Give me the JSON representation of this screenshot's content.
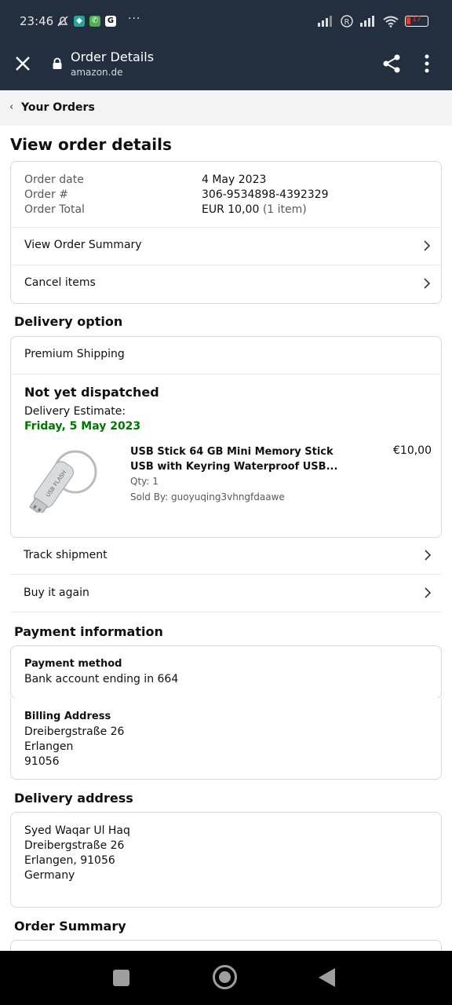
{
  "status_bar": {
    "time": "23:46",
    "battery": "17",
    "more": "···"
  },
  "browser": {
    "title": "Order Details",
    "domain": "amazon.de"
  },
  "breadcrumb": {
    "label": "Your Orders"
  },
  "page_title": "View order details",
  "order": {
    "date_label": "Order date",
    "date": "4 May 2023",
    "number_label": "Order #",
    "number": "306-9534898-4392329",
    "total_label": "Order Total",
    "total": "EUR 10,00",
    "items": "(1 item)",
    "view_summary": "View Order Summary",
    "cancel_items": "Cancel items"
  },
  "delivery": {
    "section_title": "Delivery option",
    "shipping": "Premium Shipping",
    "status": "Not yet dispatched",
    "estimate_label": "Delivery Estimate:",
    "estimate": "Friday, 5 May 2023",
    "item": {
      "name_line1": "USB Stick 64 GB Mini Memory Stick",
      "name_line2": "USB with Keyring Waterproof USB...",
      "price": "€10,00",
      "qty": "Qty: 1",
      "sold_by": "Sold By: guoyuqing3vhngfdaawe",
      "image_text": "USB FLASH"
    },
    "track": "Track shipment",
    "buy_again": "Buy it again"
  },
  "payment": {
    "section_title": "Payment information",
    "method_label": "Payment method",
    "method": "Bank account ending in 664",
    "billing_label": "Billing Address",
    "billing_lines": [
      "Dreibergstraße 26",
      "Erlangen",
      "91056"
    ]
  },
  "delivery_address": {
    "section_title": "Delivery address",
    "lines": [
      "Syed Waqar Ul Haq",
      "Dreibergstraße 26",
      "Erlangen, 91056",
      "Germany"
    ]
  },
  "order_summary": {
    "section_title": "Order Summary"
  },
  "colors": {
    "header": "#232f3e",
    "green": "#067d62",
    "accent_green": "#007600"
  }
}
